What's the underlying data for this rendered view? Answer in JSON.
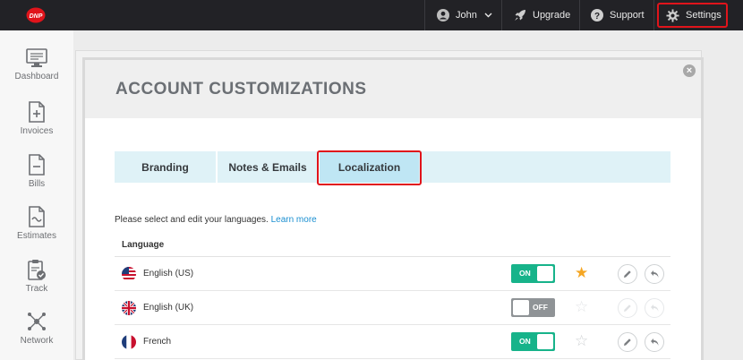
{
  "topbar": {
    "user_label": "John",
    "upgrade_label": "Upgrade",
    "support_label": "Support",
    "settings_label": "Settings",
    "highlight_color": "#e0141b"
  },
  "sidebar": {
    "items": [
      {
        "label": "Dashboard",
        "icon": "monitor-icon"
      },
      {
        "label": "Invoices",
        "icon": "invoice-icon"
      },
      {
        "label": "Bills",
        "icon": "bill-icon"
      },
      {
        "label": "Estimates",
        "icon": "estimate-icon"
      },
      {
        "label": "Track",
        "icon": "clipboard-check-icon"
      },
      {
        "label": "Network",
        "icon": "network-icon"
      }
    ]
  },
  "modal": {
    "title": "ACCOUNT CUSTOMIZATIONS",
    "close_label": "×",
    "tabs": [
      {
        "label": "Branding",
        "active": false
      },
      {
        "label": "Notes & Emails",
        "active": false
      },
      {
        "label": "Localization",
        "active": true
      }
    ],
    "intro_text": "Please select and edit your languages.",
    "learn_more_label": "Learn more",
    "column_header": "Language",
    "languages": [
      {
        "name": "English (US)",
        "flag": "us-flag",
        "toggle": "ON",
        "enabled": true,
        "default": true
      },
      {
        "name": "English (UK)",
        "flag": "uk-flag",
        "toggle": "OFF",
        "enabled": false,
        "default": false
      },
      {
        "name": "French",
        "flag": "fr-flag",
        "toggle": "ON",
        "enabled": true,
        "default": false
      }
    ],
    "colors": {
      "toggle_on": "#17b38a",
      "toggle_off": "#8f9396",
      "star_default": "#f5a623",
      "link": "#1a8fd1"
    }
  }
}
